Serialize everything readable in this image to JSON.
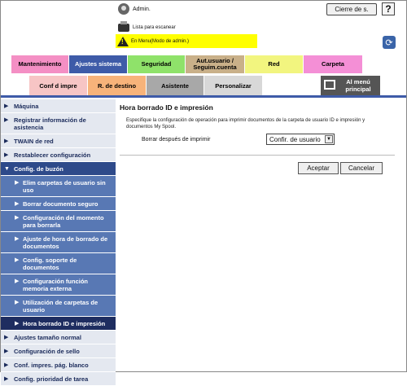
{
  "header": {
    "user_label": "Admin.",
    "logout_label": "Cierre de s.",
    "help_label": "?",
    "job_list_label": "Lista para escanear",
    "warning_text": "En Menu(Modo de admin.)"
  },
  "tabs_row1": [
    {
      "label": "Mantenimiento",
      "color": "#f48fc4"
    },
    {
      "label": "Ajustes sistema",
      "color": "#3e5ba8"
    },
    {
      "label": "Seguridad",
      "color": "#8fe26a"
    },
    {
      "label": "Aut.usuario / Seguim.cuenta",
      "color": "#c9b089"
    },
    {
      "label": "Red",
      "color": "#f2f57f"
    },
    {
      "label": "Carpeta",
      "color": "#f48fd6"
    }
  ],
  "tabs_row2": [
    {
      "label": "Conf d impre",
      "color": "#f7c5c5"
    },
    {
      "label": "R. de destino",
      "color": "#f7b37a"
    },
    {
      "label": "Asistente",
      "color": "#a8a8a8"
    },
    {
      "label": "Personalizar",
      "color": "#d8d8d8"
    },
    {
      "label": "Al menú principal",
      "color": "#555555"
    }
  ],
  "sidebar": {
    "items": [
      {
        "label": "Máquina"
      },
      {
        "label": "Registrar información de asistencia"
      },
      {
        "label": "TWAIN de red"
      },
      {
        "label": "Restablecer configuración"
      },
      {
        "label": "Config. de buzón"
      }
    ],
    "subitems": [
      {
        "label": "Elim carpetas de usuario sin uso"
      },
      {
        "label": "Borrar documento seguro"
      },
      {
        "label": "Configuración del momento para borrarla"
      },
      {
        "label": "Ajuste de hora de borrado de documentos"
      },
      {
        "label": "Config. soporte de documentos"
      },
      {
        "label": "Configuración función memoria externa"
      },
      {
        "label": "Utilización de carpetas de usuario"
      },
      {
        "label": "Hora borrado ID e impresión"
      }
    ],
    "items_after": [
      {
        "label": "Ajustes tamaño normal"
      },
      {
        "label": "Configuración de sello"
      },
      {
        "label": "Conf. impres. pág. blanco"
      },
      {
        "label": "Config. prioridad de tarea"
      }
    ]
  },
  "main": {
    "title": "Hora borrado ID e impresión",
    "description": "Especifique la configuración de operación para imprimir documentos de la carpeta de usuario ID e impresión y documentos My Spool.",
    "field_label": "Borrar después de imprimir",
    "field_value": "Confir. de usuario",
    "ok_label": "Aceptar",
    "cancel_label": "Cancelar"
  }
}
